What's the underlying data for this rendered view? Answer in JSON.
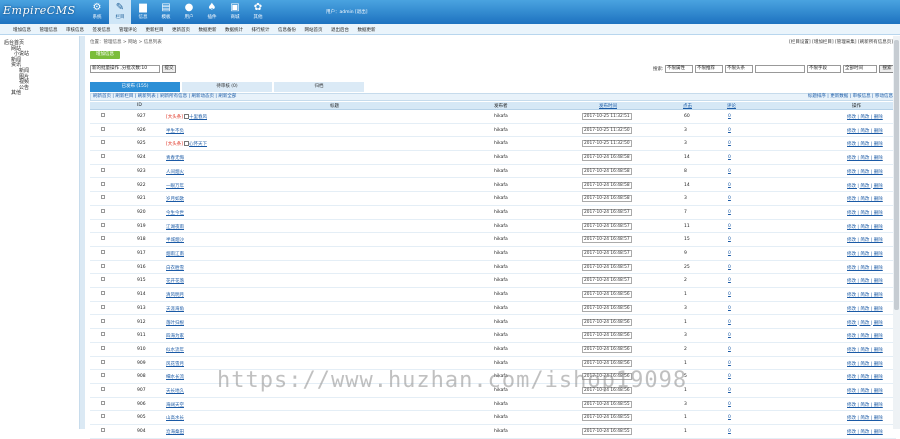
{
  "header": {
    "logo": "EmpireCMS",
    "user": "用户：admin [退出]"
  },
  "topnav": [
    {
      "label": "系统",
      "icon": "gear-icon",
      "g": "⚙"
    },
    {
      "label": "栏目",
      "icon": "doc-icon",
      "g": "✎",
      "active": true
    },
    {
      "label": "信息",
      "icon": "folder-icon",
      "g": "▆"
    },
    {
      "label": "模板",
      "icon": "list-icon",
      "g": "▤"
    },
    {
      "label": "用户",
      "icon": "user-icon",
      "g": "●"
    },
    {
      "label": "插件",
      "icon": "plugin-icon",
      "g": "♠"
    },
    {
      "label": "商城",
      "icon": "shop-icon",
      "g": "▣"
    },
    {
      "label": "其他",
      "icon": "cog-icon",
      "g": "✿"
    }
  ],
  "subnav": [
    "增加信息",
    "管理信息",
    "审核信息",
    "签发信息",
    "管理评论",
    "更新栏目",
    "更新首页",
    "数据更新",
    "数据统计",
    "排行统计",
    "信息备份",
    "网站首页",
    "退出后台",
    "数据更新"
  ],
  "sidebar": [
    "后台首页",
    "网站",
    "小说站",
    "新闻",
    "资讯",
    "新闻",
    "图片",
    "视频",
    "公告",
    "其他"
  ],
  "breadcrumb": "位置：管理信息 > 网站 > 信息列表",
  "rightlinks": "[栏目设置] [增加栏目] [管理采集] [刷新所有信息页]",
  "addbtn": "增加信息",
  "filter": {
    "left_select": "新的批量操作  ,分批次数:10",
    "left_btn": "提交",
    "search_label": "搜索:",
    "s1": "不限属性",
    "s2": "不限推荐",
    "s3": "不限头条",
    "s4": "不限字段",
    "s5": "全部时间",
    "search_btn": "搜索"
  },
  "tabs": [
    {
      "label": "已发布 (155)"
    },
    {
      "label": "待审核 (0)"
    },
    {
      "label": "归档"
    }
  ],
  "toolrow": {
    "left": "刷新首页 | 刷新栏目 | 刷新列表 | 刷新所有信息 | 刷新动态页 | 刷新全部",
    "right": "标题排序 | 更新数据 | 审核信息 | 移动信息"
  },
  "table": {
    "headers": {
      "id": "ID",
      "title": "标题",
      "author": "发布者",
      "time": "发布时间",
      "clicks": "点击",
      "comments": "评论",
      "ops": "操作"
    },
    "rows": [
      {
        "id": "927",
        "tag": "[大头条]",
        "title": "十里春风",
        "author": "hikafa",
        "time": "2017-10-25 11:32:51",
        "clicks": "60",
        "comments": "0"
      },
      {
        "id": "926",
        "tag": "",
        "title": "半生不负",
        "author": "hikafa",
        "time": "2017-10-25 11:32:50",
        "clicks": "3",
        "comments": "0"
      },
      {
        "id": "925",
        "tag": "[大头条]",
        "title": "心怀天下",
        "author": "hikafa",
        "time": "2017-10-25 11:32:50",
        "clicks": "3",
        "comments": "0"
      },
      {
        "id": "924",
        "tag": "",
        "title": "青春无悔",
        "author": "hikafa",
        "time": "2017-10-24 16:48:58",
        "clicks": "14",
        "comments": "0"
      },
      {
        "id": "923",
        "tag": "",
        "title": "人间烟火",
        "author": "hikafa",
        "time": "2017-10-24 16:48:58",
        "clicks": "8",
        "comments": "0"
      },
      {
        "id": "922",
        "tag": "",
        "title": "一眼万年",
        "author": "hikafa",
        "time": "2017-10-24 16:48:58",
        "clicks": "14",
        "comments": "0"
      },
      {
        "id": "921",
        "tag": "",
        "title": "岁月如歌",
        "author": "hikafa",
        "time": "2017-10-24 16:48:58",
        "clicks": "3",
        "comments": "0"
      },
      {
        "id": "920",
        "tag": "",
        "title": "今生今世",
        "author": "hikafa",
        "time": "2017-10-24 16:48:57",
        "clicks": "7",
        "comments": "0"
      },
      {
        "id": "919",
        "tag": "",
        "title": "江湖夜雨",
        "author": "hikafa",
        "time": "2017-10-24 16:48:57",
        "clicks": "11",
        "comments": "0"
      },
      {
        "id": "918",
        "tag": "",
        "title": "半城烟沙",
        "author": "hikafa",
        "time": "2017-10-24 16:48:57",
        "clicks": "15",
        "comments": "0"
      },
      {
        "id": "917",
        "tag": "",
        "title": "烟雨江南",
        "author": "hikafa",
        "time": "2017-10-24 16:48:57",
        "clicks": "9",
        "comments": "0"
      },
      {
        "id": "916",
        "tag": "",
        "title": "白衣胜雪",
        "author": "hikafa",
        "time": "2017-10-24 16:48:57",
        "clicks": "25",
        "comments": "0"
      },
      {
        "id": "915",
        "tag": "",
        "title": "花开花落",
        "author": "hikafa",
        "time": "2017-10-24 16:48:57",
        "clicks": "2",
        "comments": "0"
      },
      {
        "id": "914",
        "tag": "",
        "title": "清风明月",
        "author": "hikafa",
        "time": "2017-10-24 16:48:56",
        "clicks": "1",
        "comments": "0"
      },
      {
        "id": "913",
        "tag": "",
        "title": "天涯海角",
        "author": "hikafa",
        "time": "2017-10-24 16:48:56",
        "clicks": "3",
        "comments": "0"
      },
      {
        "id": "912",
        "tag": "",
        "title": "落叶归根",
        "author": "hikafa",
        "time": "2017-10-24 16:48:56",
        "clicks": "1",
        "comments": "0"
      },
      {
        "id": "911",
        "tag": "",
        "title": "四海为家",
        "author": "hikafa",
        "time": "2017-10-24 16:48:56",
        "clicks": "3",
        "comments": "0"
      },
      {
        "id": "910",
        "tag": "",
        "title": "似水流年",
        "author": "hikafa",
        "time": "2017-10-24 16:48:56",
        "clicks": "2",
        "comments": "0"
      },
      {
        "id": "909",
        "tag": "",
        "title": "风花雪月",
        "author": "hikafa",
        "time": "2017-10-24 16:48:56",
        "clicks": "1",
        "comments": "0"
      },
      {
        "id": "908",
        "tag": "",
        "title": "细水长流",
        "author": "hikafa",
        "time": "2017-10-24 16:48:56",
        "clicks": "5",
        "comments": "0"
      },
      {
        "id": "907",
        "tag": "",
        "title": "天长地久",
        "author": "hikafa",
        "time": "2017-10-24 16:48:56",
        "clicks": "1",
        "comments": "0"
      },
      {
        "id": "906",
        "tag": "",
        "title": "海阔天空",
        "author": "hikafa",
        "time": "2017-10-24 16:48:55",
        "clicks": "3",
        "comments": "0"
      },
      {
        "id": "905",
        "tag": "",
        "title": "山高水长",
        "author": "hikafa",
        "time": "2017-10-24 16:48:55",
        "clicks": "1",
        "comments": "0"
      },
      {
        "id": "904",
        "tag": "",
        "title": "沧海桑田",
        "author": "hikafa",
        "time": "2017-10-24 16:48:55",
        "clicks": "1",
        "comments": "0"
      }
    ],
    "ops": "修改 | 简改 | 删除"
  },
  "watermark": "https://www.huzhan.com/ishop19098"
}
